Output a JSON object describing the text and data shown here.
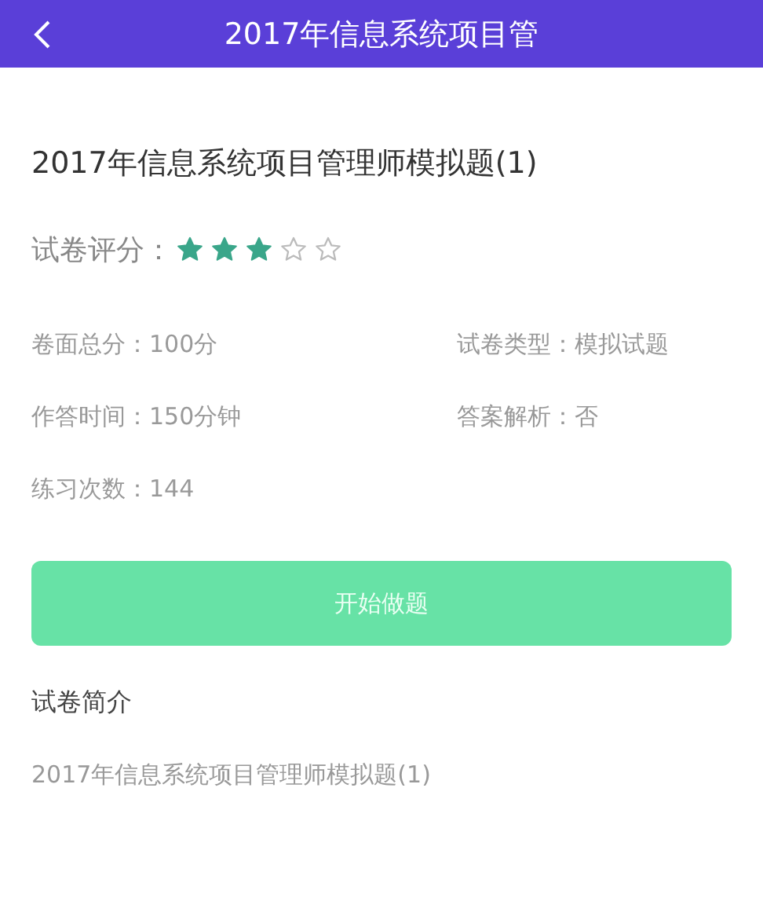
{
  "header": {
    "title": "2017年信息系统项目管"
  },
  "exam": {
    "title": "2017年信息系统项目管理师模拟题(1)"
  },
  "rating": {
    "label": "试卷评分：",
    "stars": 3
  },
  "info": [
    {
      "text": "卷面总分：100分"
    },
    {
      "text": "试卷类型：模拟试题"
    },
    {
      "text": "作答时间：150分钟"
    },
    {
      "text": "答案解析：否"
    },
    {
      "text": "练习次数：144"
    }
  ],
  "start_button": {
    "label": "开始做题"
  },
  "intro": {
    "heading": "试卷简介",
    "text": "2017年信息系统项目管理师模拟题(1)"
  }
}
